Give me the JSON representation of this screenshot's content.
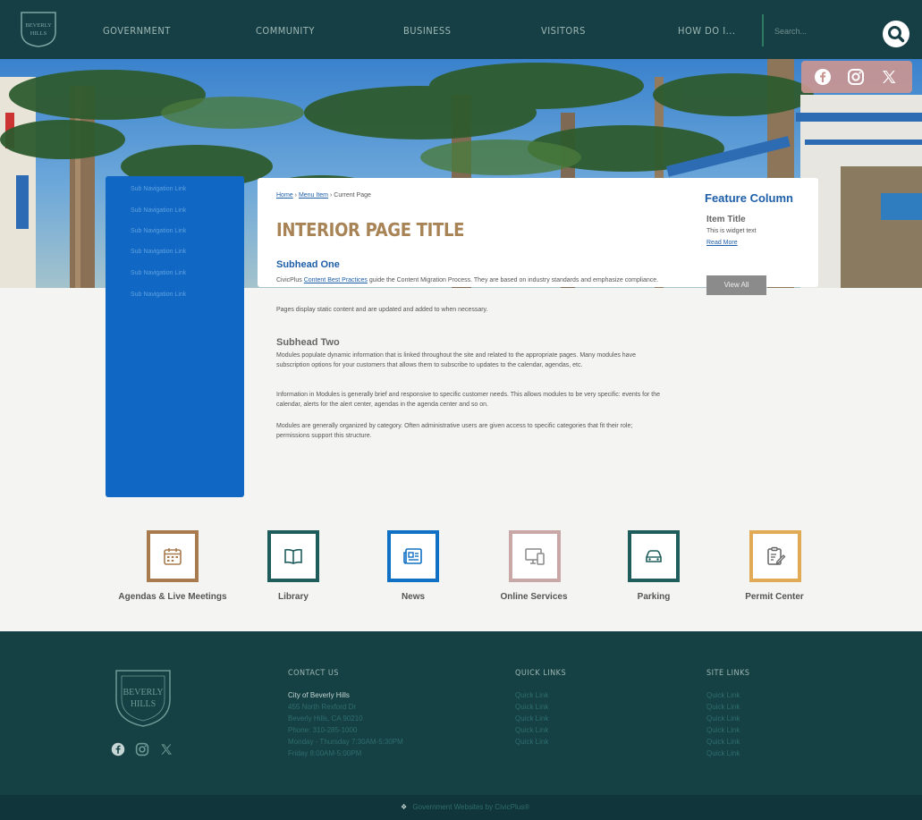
{
  "nav": {
    "items": [
      "GOVERNMENT",
      "COMMUNITY",
      "BUSINESS",
      "VISITORS",
      "HOW DO I..."
    ],
    "search_placeholder": "Search..."
  },
  "sidebar": {
    "items": [
      "Sub Navigation Link",
      "Sub Navigation Link",
      "Sub Navigation Link",
      "Sub Navigation Link",
      "Sub Navigation Link",
      "Sub Navigation Link"
    ]
  },
  "main": {
    "breadcrumb": {
      "home": "Home",
      "parent": "Menu Item",
      "current": "Current Page",
      "sep": "›"
    },
    "title": "INTERIOR PAGE TITLE",
    "subhead_one": "Subhead One",
    "para1_start": "CivicPlus ",
    "para1_link": "Content Best Practices",
    "para1_rest": " guide the Content Migration Process. They are based on industry standards and emphasize compliance.",
    "para2": "Pages display static content and are updated and added to when necessary.",
    "subhead_two": "Subhead Two",
    "para3": "Modules populate dynamic information that is linked throughout the site and related to the appropriate pages. Many modules have subscription options for your customers that allows them to subscribe to updates to the calendar, agendas, etc.",
    "para4": "Information in Modules is generally brief and responsive to specific customer needs. This allows modules to be very specific: events for the calendar, alerts for the alert center, agendas in the agenda center and so on.",
    "para5": "Modules are generally organized by category. Often administrative users are given access to specific categories that fit their role; permissions support this structure."
  },
  "feature": {
    "title": "Feature Column",
    "item_title": "Item Title",
    "widget_text": "This is widget text",
    "read_more": "Read More",
    "view_all": "View All"
  },
  "quick_links": [
    {
      "label": "Agendas & Live Meetings",
      "color": "#a87b4e",
      "icon": "calendar-icon"
    },
    {
      "label": "Library",
      "color": "#1f5d5c",
      "icon": "book-icon"
    },
    {
      "label": "News",
      "color": "#1070c4",
      "icon": "newspaper-icon"
    },
    {
      "label": "Online Services",
      "color": "#c9a7a7",
      "icon": "devices-icon"
    },
    {
      "label": "Parking",
      "color": "#1f5d5c",
      "icon": "car-icon"
    },
    {
      "label": "Permit Center",
      "color": "#e1aa54",
      "icon": "clipboard-icon"
    }
  ],
  "footer": {
    "contact_heading": "CONTACT US",
    "contact_lines": [
      "City of Beverly Hills",
      "455 North Rexford Dr",
      "Beverly Hills, CA 90210",
      "Phone: 310-285-1000",
      "Monday - Thursday 7:30AM-5:30PM",
      "Friday 8:00AM-5:00PM"
    ],
    "quick_heading": "QUICK LINKS",
    "quick_links": [
      "Quick Link",
      "Quick Link",
      "Quick Link",
      "Quick Link",
      "Quick Link"
    ],
    "site_heading": "SITE LINKS",
    "site_links": [
      "Quick Link",
      "Quick Link",
      "Quick Link",
      "Quick Link",
      "Quick Link",
      "Quick Link"
    ],
    "copyright": "Government Websites by CivicPlus®"
  },
  "logo": {
    "line1": "BEVERLY",
    "line2": "HILLS"
  },
  "colors": {
    "header": "#163f45",
    "sidebar": "#1067c4",
    "title": "#a88356",
    "link": "#1d5ea8",
    "footer": "#154044"
  }
}
